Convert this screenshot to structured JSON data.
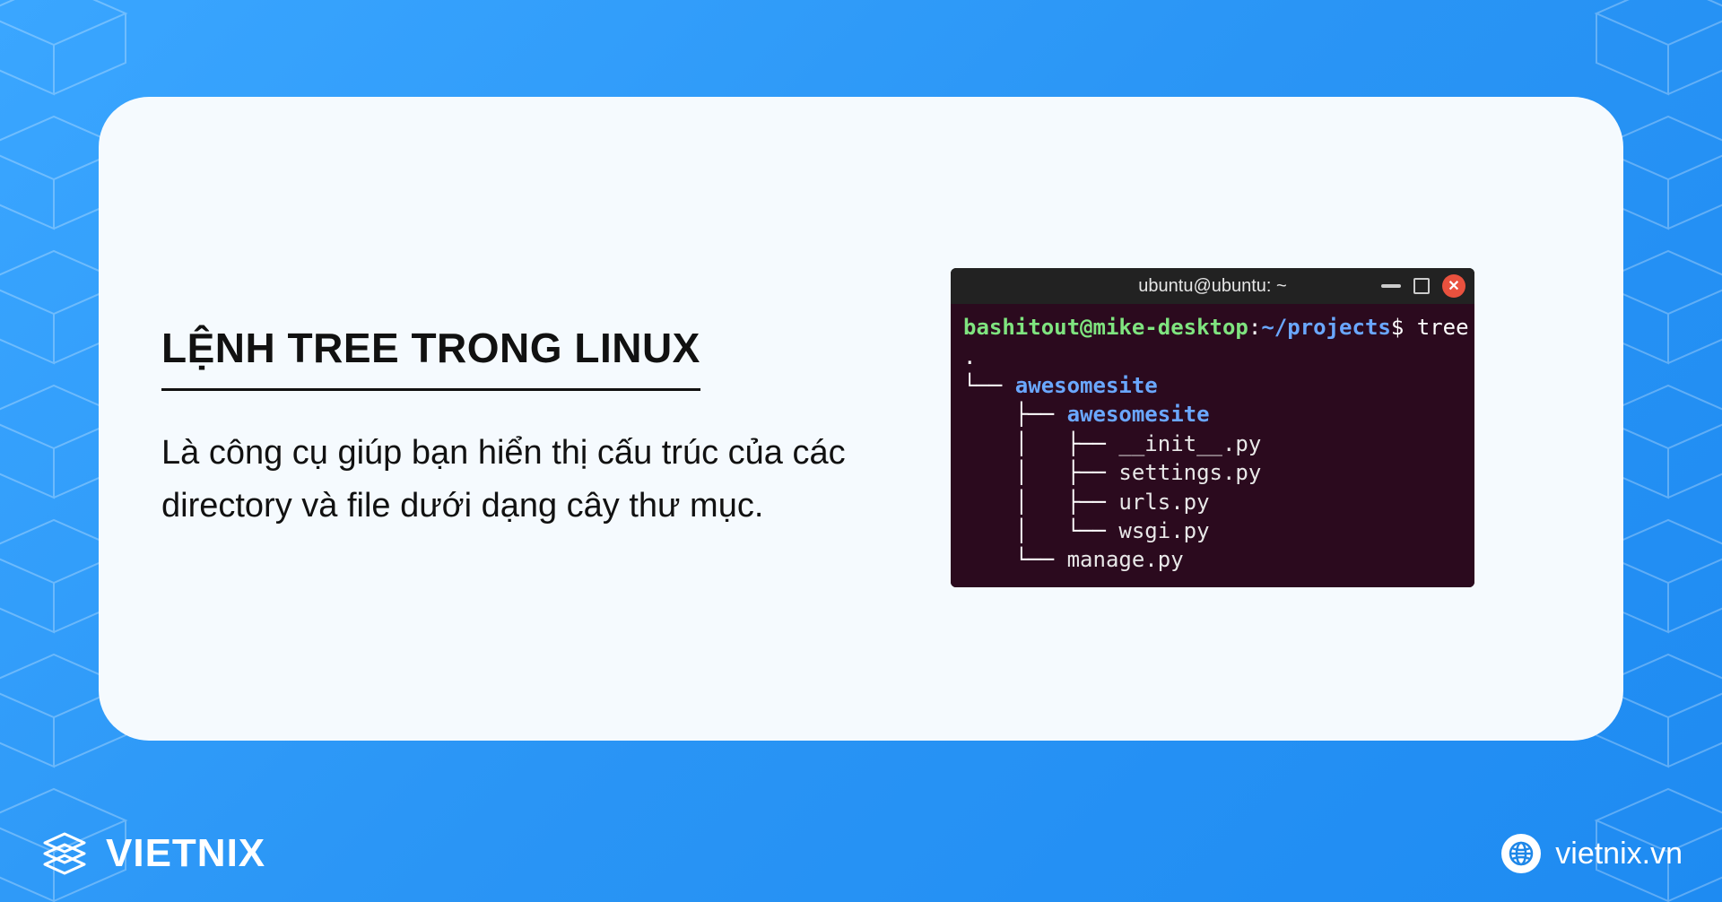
{
  "card": {
    "title": "LỆNH TREE TRONG LINUX",
    "description": "Là công cụ giúp bạn hiển thị cấu trúc của các directory và file dưới dạng cây thư mục."
  },
  "terminal": {
    "window_title": "ubuntu@ubuntu: ~",
    "prompt_user_host": "bashitout@mike-desktop",
    "prompt_path": "~/projects",
    "prompt_symbol": "$",
    "command": "tree",
    "tree_lines": [
      {
        "prefix": ".",
        "name": "",
        "kind": "plain"
      },
      {
        "prefix": "└── ",
        "name": "awesomesite",
        "kind": "dir"
      },
      {
        "prefix": "    ├── ",
        "name": "awesomesite",
        "kind": "dir"
      },
      {
        "prefix": "    │   ├── ",
        "name": "__init__.py",
        "kind": "file"
      },
      {
        "prefix": "    │   ├── ",
        "name": "settings.py",
        "kind": "file"
      },
      {
        "prefix": "    │   ├── ",
        "name": "urls.py",
        "kind": "file"
      },
      {
        "prefix": "    │   └── ",
        "name": "wsgi.py",
        "kind": "file"
      },
      {
        "prefix": "    └── ",
        "name": "manage.py",
        "kind": "file"
      }
    ]
  },
  "footer": {
    "brand": "VIETNIX",
    "site": "vietnix.vn"
  }
}
